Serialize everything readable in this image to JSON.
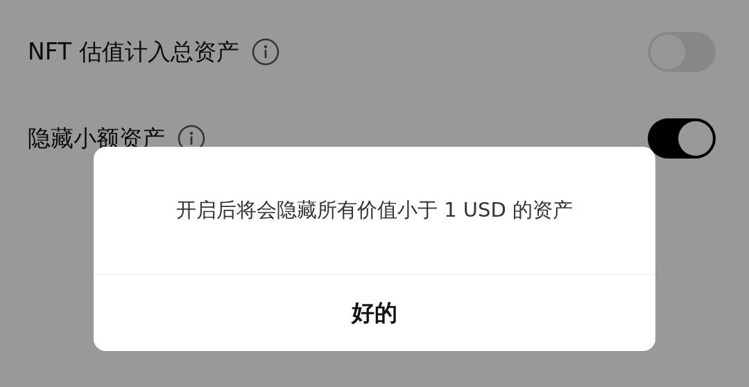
{
  "settings": [
    {
      "label": "NFT 估值计入总资产",
      "on": false
    },
    {
      "label": "隐藏小额资产",
      "on": true
    }
  ],
  "dialog": {
    "message": "开启后将会隐藏所有价值小于 1 USD 的资产",
    "button": "好的"
  }
}
